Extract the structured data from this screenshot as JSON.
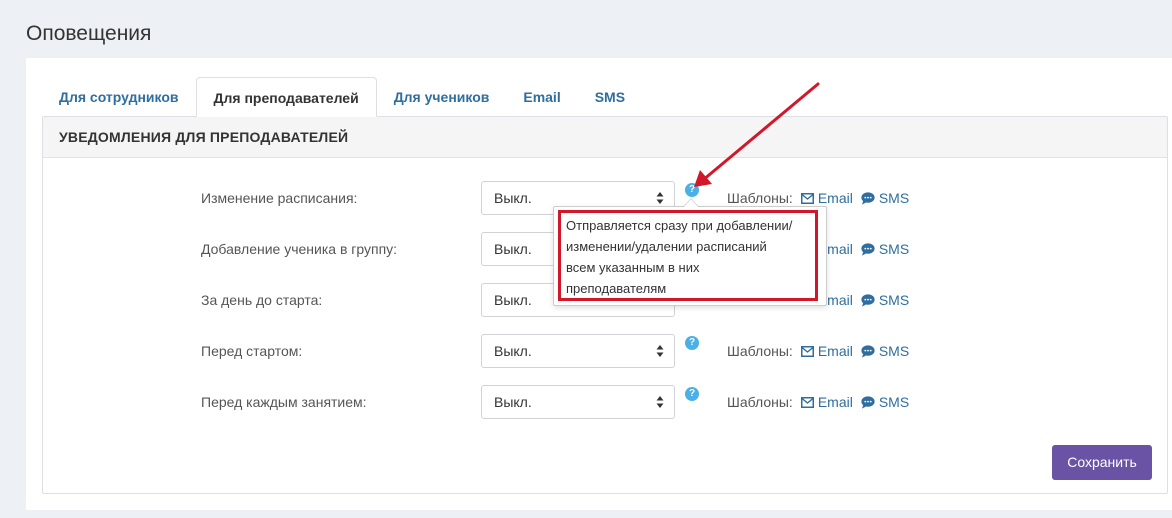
{
  "page": {
    "title": "Оповещения"
  },
  "tabs": [
    {
      "label": "Для сотрудников",
      "active": false
    },
    {
      "label": "Для преподавателей",
      "active": true
    },
    {
      "label": "Для учеников",
      "active": false
    },
    {
      "label": "Email",
      "active": false
    },
    {
      "label": "SMS",
      "active": false
    }
  ],
  "panel": {
    "heading": "УВЕДОМЛЕНИЯ ДЛЯ ПРЕПОДАВАТЕЛЕЙ",
    "templates_label": "Шаблоны:",
    "email_link": "Email",
    "sms_link": "SMS",
    "help_icon": "?",
    "rows": [
      {
        "label": "Изменение расписания:",
        "value": "Выкл."
      },
      {
        "label": "Добавление ученика в группу:",
        "value": "Выкл."
      },
      {
        "label": "За день до старта:",
        "value": "Выкл."
      },
      {
        "label": "Перед стартом:",
        "value": "Выкл."
      },
      {
        "label": "Перед каждым занятием:",
        "value": "Выкл."
      }
    ],
    "save_label": "Сохранить"
  },
  "tooltip": {
    "lines": [
      "Отправляется сразу при добавлении/",
      "изменении/удалении расписаний",
      "всем указанным в них",
      "преподавателям"
    ]
  },
  "colors": {
    "accent_link": "#2f6e9e",
    "save_button": "#6a52a4",
    "help_icon": "#4ab0e6",
    "annotation": "#d3172a"
  }
}
